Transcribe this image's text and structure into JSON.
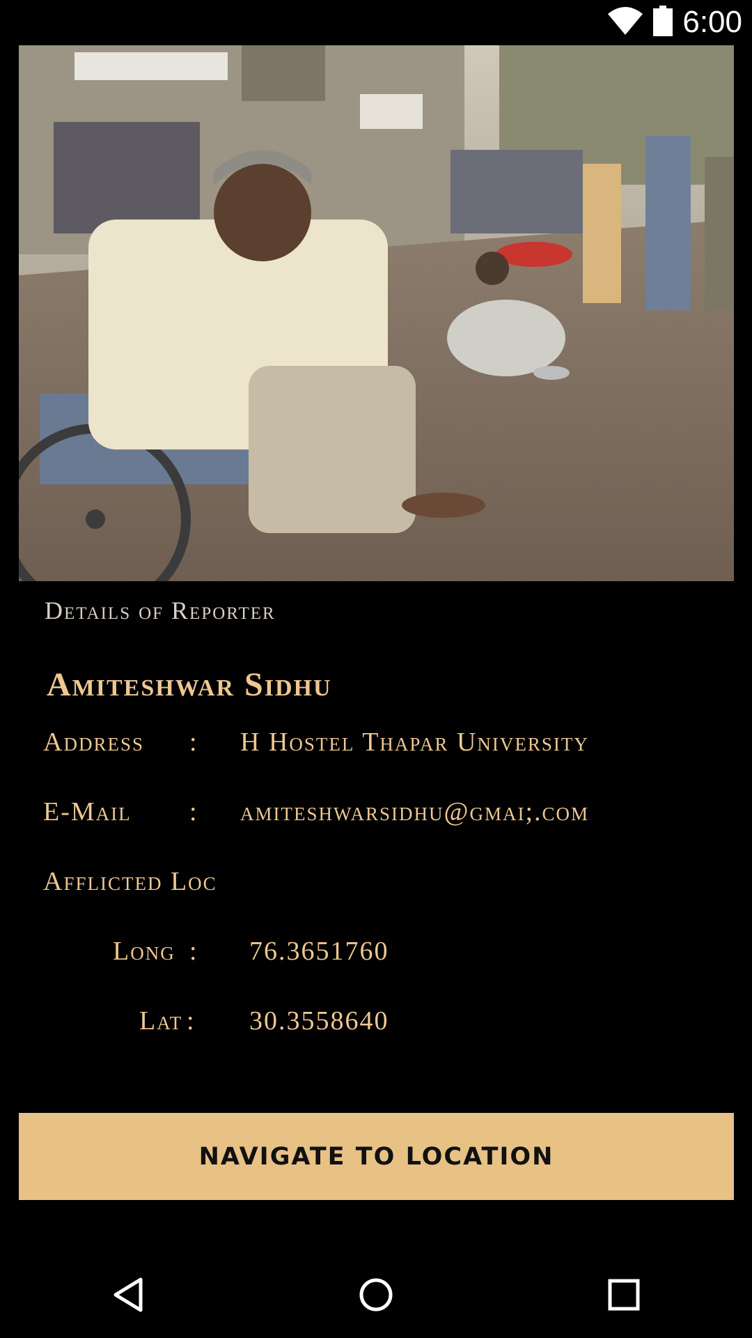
{
  "status_bar": {
    "time": "6:00",
    "wifi_icon": "wifi-icon",
    "battery_icon": "battery-icon"
  },
  "photo": {
    "description_icon": "reporter-photo"
  },
  "details": {
    "section_title": "Details of Reporter",
    "name": "Amiteshwar Sidhu",
    "address_label": "Address",
    "address_colon": ":",
    "address_value": "H Hostel Thapar University",
    "email_label": "E-Mail",
    "email_colon": ":",
    "email_value": "amiteshwarsidhu@gmai;.com",
    "afflicted_label": "Afflicted Loc",
    "long_label": "Long",
    "long_colon": ":",
    "long_value": "76.3651760",
    "lat_label": "Lat",
    "lat_colon": ":",
    "lat_value": "30.3558640"
  },
  "actions": {
    "navigate_label": "NAVIGATE TO LOCATION"
  },
  "nav_bar": {
    "back_icon": "back-icon",
    "home_icon": "home-icon",
    "recents_icon": "recents-icon"
  }
}
